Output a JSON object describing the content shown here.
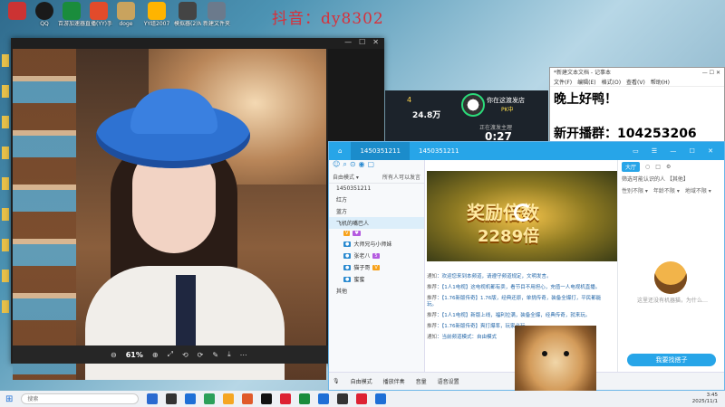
{
  "watermark": "抖音：dy8302",
  "desktop_icons": [
    {
      "label": "",
      "color": "#c33"
    },
    {
      "label": "QQ",
      "color": "#1a1a1a"
    },
    {
      "label": "百游加速器",
      "color": "#1a8c3c"
    },
    {
      "label": "直播(YY)手机版",
      "color": "#e24b2b"
    },
    {
      "label": "doge",
      "color": "#c9a35e"
    },
    {
      "label": "YY组2007",
      "color": "#ffb400"
    },
    {
      "label": "模拟器(2)NG...",
      "color": "#444"
    },
    {
      "label": "新建文件夹(YY)...",
      "color": "#6b7a8c"
    }
  ],
  "viewer": {
    "zoom": "61%",
    "tools": [
      "⊖",
      "⊕",
      "⤢",
      "⟲",
      "⟳",
      "✎",
      "⤓",
      "⋯"
    ]
  },
  "live": {
    "coins": "4",
    "views": "24.8万",
    "follow": "你在这渡发店",
    "pk": "PK中",
    "status": "正在渡发主理",
    "timer": "0:27"
  },
  "notepad": {
    "title": "*新建文本文档 - 记事本",
    "controls": "—  ☐  ✕",
    "menu": [
      "文件(F)",
      "编辑(E)",
      "格式(O)",
      "查看(V)",
      "帮助(H)"
    ],
    "line1": "晚上好鸭！",
    "line2": "新开播群：104253206"
  },
  "yy": {
    "tabs": [
      "1450351211",
      "1450351211"
    ],
    "controls": "▭ ☰ — ☐ ✕",
    "mode": "自由模式 ▾",
    "mode_right": "所有人可以发言",
    "channels": [
      "1450351211",
      "红方",
      "蓝方",
      "飞机的嘴巴人"
    ],
    "users": [
      "大师兄与小师妹",
      "张老八",
      "猫子哥",
      "蜜蜜"
    ],
    "last_channel": "其他",
    "video_tabs": "",
    "video_text1": "奖励倍数",
    "video_text2": "2289倍",
    "chat": [
      {
        "tag": "通知",
        "text": "欢迎您来到本频道，请遵守频道规定，文明发言。"
      },
      {
        "tag": "推荐",
        "text": "【1人1电视】这电视机都有卖，看节目不用担心，充值一人电视机直播。"
      },
      {
        "tag": "推荐",
        "text": "【1.76新版传奇】1.76版，经典还原，单挑传奇，装备全爆打，平民都能玩。"
      },
      {
        "tag": "推荐",
        "text": "【1人1电视】新版上线，福利拉满，装备全爆，经典传奇，就来玩。"
      },
      {
        "tag": "推荐",
        "text": "【1.76新版传奇】爽打爆率，玩家必玩。"
      },
      {
        "tag": "通知",
        "text": "当前频道模式：自由模式"
      }
    ],
    "bottom": [
      "自由模式",
      "播放伴奏",
      "音量",
      "语音设置"
    ],
    "right_tabs": [
      "大厅",
      "○",
      "□",
      "⚙"
    ],
    "right_filter": "筛选可能认识的人 【其他】",
    "right_drops": [
      "性别不限 ▾",
      "年龄不限 ▾",
      "地域不限 ▾"
    ],
    "empty_text": "这里还没有机器猫，为什么…",
    "find_button": "我要找搭子"
  },
  "taskbar": {
    "search": "搜索",
    "time": "3:45",
    "date": "2025/11/1",
    "icon_colors": [
      "#2a6ad0",
      "#333",
      "#1e6fd6",
      "#2ca05a",
      "#f5a623",
      "#e05a2a",
      "#111",
      "#d23",
      "#1a8c3c",
      "#1e6fd6",
      "#333",
      "#d23",
      "#1e6fd6"
    ]
  }
}
